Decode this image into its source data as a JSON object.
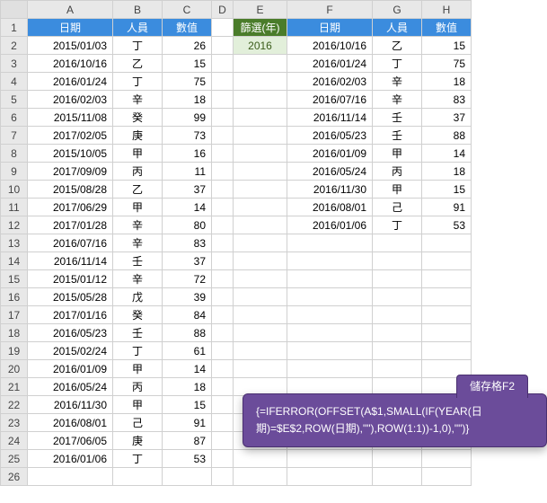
{
  "colHeaders": [
    "A",
    "B",
    "C",
    "D",
    "E",
    "F",
    "G",
    "H"
  ],
  "tableA": {
    "headers": [
      "日期",
      "人員",
      "數值"
    ],
    "rows": [
      [
        "2015/01/03",
        "丁",
        "26"
      ],
      [
        "2016/10/16",
        "乙",
        "15"
      ],
      [
        "2016/01/24",
        "丁",
        "75"
      ],
      [
        "2016/02/03",
        "辛",
        "18"
      ],
      [
        "2015/11/08",
        "癸",
        "99"
      ],
      [
        "2017/02/05",
        "庚",
        "73"
      ],
      [
        "2015/10/05",
        "甲",
        "16"
      ],
      [
        "2017/09/09",
        "丙",
        "11"
      ],
      [
        "2015/08/28",
        "乙",
        "37"
      ],
      [
        "2017/06/29",
        "甲",
        "14"
      ],
      [
        "2017/01/28",
        "辛",
        "80"
      ],
      [
        "2016/07/16",
        "辛",
        "83"
      ],
      [
        "2016/11/14",
        "壬",
        "37"
      ],
      [
        "2015/01/12",
        "辛",
        "72"
      ],
      [
        "2015/05/28",
        "戊",
        "39"
      ],
      [
        "2017/01/16",
        "癸",
        "84"
      ],
      [
        "2016/05/23",
        "壬",
        "88"
      ],
      [
        "2015/02/24",
        "丁",
        "61"
      ],
      [
        "2016/01/09",
        "甲",
        "14"
      ],
      [
        "2016/05/24",
        "丙",
        "18"
      ],
      [
        "2016/11/30",
        "甲",
        "15"
      ],
      [
        "2016/08/01",
        "己",
        "91"
      ],
      [
        "2017/06/05",
        "庚",
        "87"
      ],
      [
        "2016/01/06",
        "丁",
        "53"
      ]
    ]
  },
  "filter": {
    "label": "篩選(年)",
    "value": "2016"
  },
  "tableF": {
    "headers": [
      "日期",
      "人員",
      "數值"
    ],
    "rows": [
      [
        "2016/10/16",
        "乙",
        "15"
      ],
      [
        "2016/01/24",
        "丁",
        "75"
      ],
      [
        "2016/02/03",
        "辛",
        "18"
      ],
      [
        "2016/07/16",
        "辛",
        "83"
      ],
      [
        "2016/11/14",
        "壬",
        "37"
      ],
      [
        "2016/05/23",
        "壬",
        "88"
      ],
      [
        "2016/01/09",
        "甲",
        "14"
      ],
      [
        "2016/05/24",
        "丙",
        "18"
      ],
      [
        "2016/11/30",
        "甲",
        "15"
      ],
      [
        "2016/08/01",
        "己",
        "91"
      ],
      [
        "2016/01/06",
        "丁",
        "53"
      ]
    ]
  },
  "callout": {
    "title": "儲存格F2",
    "formula": "{=IFERROR(OFFSET(A$1,SMALL(IF(YEAR(日期)=$E$2,ROW(日期),\"\"),ROW(1:1))-1,0),\"\")}"
  },
  "totalRows": 26
}
